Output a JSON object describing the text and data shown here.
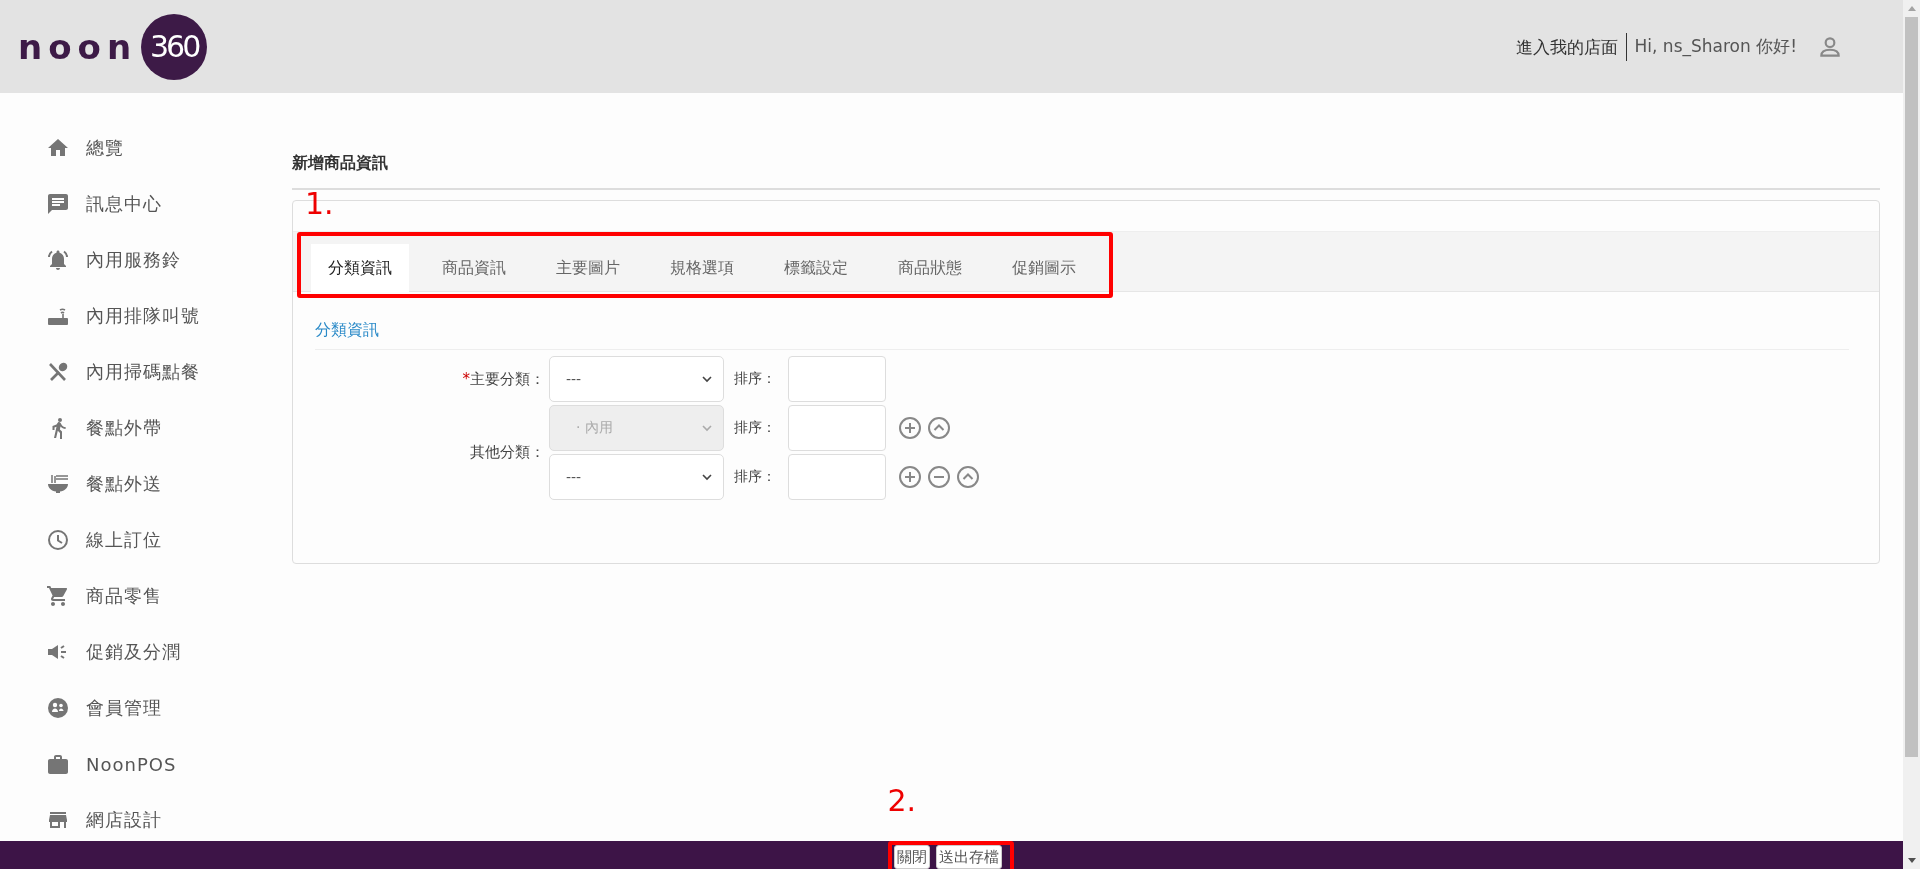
{
  "header": {
    "logo": {
      "word": "noon",
      "badge": "360"
    },
    "store_link": "進入我的店面",
    "greeting": "Hi, ns_Sharon 你好!"
  },
  "sidebar": {
    "items": [
      {
        "label": "總覽"
      },
      {
        "label": "訊息中心"
      },
      {
        "label": "內用服務鈴"
      },
      {
        "label": "內用排隊叫號"
      },
      {
        "label": "內用掃碼點餐"
      },
      {
        "label": "餐點外帶"
      },
      {
        "label": "餐點外送"
      },
      {
        "label": "線上訂位"
      },
      {
        "label": "商品零售"
      },
      {
        "label": "促銷及分潤"
      },
      {
        "label": "會員管理"
      },
      {
        "label": "NoonPOS"
      },
      {
        "label": "網店設計"
      }
    ]
  },
  "page_title": "新增商品資訊",
  "tabs": [
    {
      "label": "分類資訊",
      "selected": true
    },
    {
      "label": "商品資訊",
      "selected": false
    },
    {
      "label": "主要圖片",
      "selected": false
    },
    {
      "label": "規格選項",
      "selected": false
    },
    {
      "label": "標籤設定",
      "selected": false
    },
    {
      "label": "商品狀態",
      "selected": false
    },
    {
      "label": "促銷圖示",
      "selected": false
    }
  ],
  "section_title": "分類資訊",
  "form": {
    "main": {
      "required_mark": "*",
      "label": "主要分類：",
      "value": "---",
      "sort_label": "排序："
    },
    "others": {
      "label": "其他分類：",
      "rows": [
        {
          "kind": "first",
          "value": "· 內用",
          "disabled": true,
          "sort_label": "排序："
        },
        {
          "kind": "extra",
          "value": "---",
          "disabled": false,
          "sort_label": "排序："
        }
      ]
    }
  },
  "footer": {
    "buttons": [
      "關閉",
      "送出存檔"
    ]
  },
  "annotations": [
    {
      "label": "1."
    },
    {
      "label": "2."
    }
  ]
}
